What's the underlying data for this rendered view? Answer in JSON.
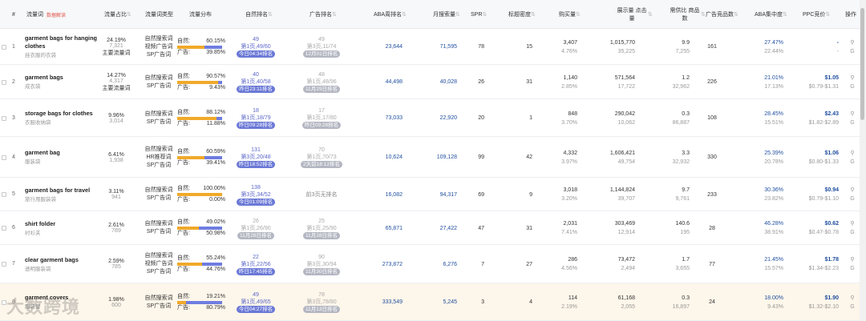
{
  "header": {
    "idx": "#",
    "keyword": "流量词",
    "keyword_tag": "数据解读",
    "share": "流量占比",
    "word_type": "流量词类型",
    "distribution": "流量分布",
    "natural_rank": "自然排名",
    "ad_rank": "广告排名",
    "aba_rank": "ABA周排名",
    "monthly_search": "月搜索量",
    "spr": "SPR",
    "title_density": "标题密度",
    "buy_volume": "购买量",
    "impr_click": "展示量 点击量",
    "supply_demand": "需供比 商品数",
    "ad_products": "广告竞品数",
    "aba_concentration": "ABA集中度",
    "ppc_bid": "PPC竞价",
    "action": "操作"
  },
  "labels": {
    "natural": "自然:",
    "ad": "广告:"
  },
  "rows": [
    {
      "idx": "1",
      "kw": "garment bags for hanging clothes",
      "kw_cn": "挂衣服的衣袋",
      "share": "24.19%",
      "share_n": "7,321",
      "share_t": "主要流量词",
      "type1": "自然搜索词",
      "type2": "视频广告词",
      "type3": "SP广告词",
      "nat": "60.15%",
      "adp": "39.85%",
      "nat_v": 0.6015,
      "nr1": "49",
      "nr2": "第1页,49/60",
      "nr3": "今日04:34排名",
      "nr_gray": false,
      "ar1": "49",
      "ar2": "第3页,11/74",
      "ar3": "12月01日排名",
      "aba": "23,644",
      "ms": "71,595",
      "spr": "78",
      "td": "15",
      "buy1": "3,407",
      "buy2": "4.76%",
      "imp1": "1,015,770",
      "imp2": "35,225",
      "sd1": "9.9",
      "sd2": "7,255",
      "adc": "161",
      "abc1": "27.47%",
      "abc2": "22.44%",
      "ppc1": "-",
      "ppc2": "-",
      "hl": false
    },
    {
      "idx": "2",
      "kw": "garment bags",
      "kw_cn": "成衣袋",
      "share": "14.27%",
      "share_n": "4,317",
      "share_t": "主要流量词",
      "type1": "自然搜索词",
      "type2": "SP广告词",
      "type3": "",
      "nat": "90.57%",
      "adp": "9.43%",
      "nat_v": 0.9057,
      "nr1": "40",
      "nr2": "第1页,40/58",
      "nr3": "昨日23:11排名",
      "nr_gray": false,
      "ar1": "48",
      "ar2": "第1页,48/96",
      "ar3": "11月29日排名",
      "aba": "44,498",
      "ms": "40,028",
      "spr": "26",
      "td": "31",
      "buy1": "1,140",
      "buy2": "2.85%",
      "imp1": "571,564",
      "imp2": "17,722",
      "sd1": "1.2",
      "sd2": "32,962",
      "adc": "226",
      "abc1": "21.01%",
      "abc2": "17.13%",
      "ppc1": "$1.05",
      "ppc2": "$0.79-$1.31",
      "hl": false
    },
    {
      "idx": "3",
      "kw": "storage bags for clothes",
      "kw_cn": "衣服收纳袋",
      "share": "9.96%",
      "share_n": "3,014",
      "share_t": "",
      "type1": "自然搜索词",
      "type2": "SP广告词",
      "type3": "",
      "nat": "88.12%",
      "adp": "11.88%",
      "nat_v": 0.8812,
      "nr1": "18",
      "nr2": "第1页,18/79",
      "nr3": "昨日09:28排名",
      "nr_gray": false,
      "ar1": "17",
      "ar2": "第1页,17/80",
      "ar3": "昨日09:28排名",
      "aba": "73,033",
      "ms": "22,920",
      "spr": "20",
      "td": "1",
      "buy1": "848",
      "buy2": "3.70%",
      "imp1": "290,042",
      "imp2": "10,062",
      "sd1": "0.3",
      "sd2": "86,887",
      "adc": "108",
      "abc1": "28.45%",
      "abc2": "15.51%",
      "ppc1": "$2.43",
      "ppc2": "$1.82-$2.89",
      "hl": false
    },
    {
      "idx": "4",
      "kw": "garment bag",
      "kw_cn": "服装袋",
      "share": "6.41%",
      "share_n": "1,938",
      "share_t": "",
      "type1": "自然搜索词",
      "type2": "HR推荐词",
      "type3": "SP广告词",
      "nat": "60.59%",
      "adp": "39.41%",
      "nat_v": 0.6059,
      "nr1": "131",
      "nr2": "第3页,20/48",
      "nr3": "昨日18:52排名",
      "nr_gray": false,
      "ar1": "70",
      "ar2": "第1页,70/73",
      "ar3": "2天前18:12排名",
      "aba": "10,624",
      "ms": "109,128",
      "spr": "99",
      "td": "42",
      "buy1": "4,332",
      "buy2": "3.97%",
      "imp1": "1,606,421",
      "imp2": "49,754",
      "sd1": "3.3",
      "sd2": "32,932",
      "adc": "330",
      "abc1": "25.39%",
      "abc2": "20.78%",
      "ppc1": "$1.06",
      "ppc2": "$0.80-$1.33",
      "hl": false
    },
    {
      "idx": "5",
      "kw": "garment bags for travel",
      "kw_cn": "旅行用服装袋",
      "share": "3.11%",
      "share_n": "941",
      "share_t": "",
      "type1": "自然搜索词",
      "type2": "SP广告词",
      "type3": "",
      "nat": "100.00%",
      "adp": "0.00%",
      "nat_v": 1.0,
      "nr1": "138",
      "nr2": "第3页,34/52",
      "nr3": "今日01:09排名",
      "nr_gray": false,
      "ar1": "",
      "ar2": "前3页无排名",
      "ar3": "",
      "aba": "16,082",
      "ms": "94,317",
      "spr": "69",
      "td": "9",
      "buy1": "3,018",
      "buy2": "3.20%",
      "imp1": "1,144,824",
      "imp2": "39,707",
      "sd1": "9.7",
      "sd2": "9,761",
      "adc": "233",
      "abc1": "30.36%",
      "abc2": "23.82%",
      "ppc1": "$0.94",
      "ppc2": "$0.79-$1.10",
      "hl": false
    },
    {
      "idx": "6",
      "kw": "shirt folder",
      "kw_cn": "衬衫夹",
      "share": "2.61%",
      "share_n": "789",
      "share_t": "",
      "type1": "自然搜索词",
      "type2": "SP广告词",
      "type3": "",
      "nat": "49.02%",
      "adp": "50.98%",
      "nat_v": 0.4902,
      "nr1": "26",
      "nr2": "第1页,26/90",
      "nr3": "11月28日排名",
      "nr_gray": true,
      "ar1": "25",
      "ar2": "第1页,25/90",
      "ar3": "11月28日排名",
      "aba": "65,871",
      "ms": "27,422",
      "spr": "47",
      "td": "31",
      "buy1": "2,031",
      "buy2": "7.41%",
      "imp1": "303,469",
      "imp2": "12,914",
      "sd1": "140.6",
      "sd2": "195",
      "adc": "28",
      "abc1": "46.28%",
      "abc2": "38.91%",
      "ppc1": "$0.62",
      "ppc2": "$0.47-$0.78",
      "hl": false
    },
    {
      "idx": "7",
      "kw": "clear garment bags",
      "kw_cn": "透明服装袋",
      "share": "2.59%",
      "share_n": "785",
      "share_t": "",
      "type1": "自然搜索词",
      "type2": "视频广告词",
      "type3": "SP广告词",
      "nat": "55.24%",
      "adp": "44.76%",
      "nat_v": 0.5524,
      "nr1": "22",
      "nr2": "第1页,22/56",
      "nr3": "昨日17:45排名",
      "nr_gray": false,
      "ar1": "90",
      "ar2": "第3页,30/94",
      "ar3": "11月30日排名",
      "aba": "273,872",
      "ms": "6,276",
      "spr": "7",
      "td": "27",
      "buy1": "286",
      "buy2": "4.56%",
      "imp1": "73,472",
      "imp2": "2,494",
      "sd1": "1.7",
      "sd2": "3,655",
      "adc": "77",
      "abc1": "21.45%",
      "abc2": "15.57%",
      "ppc1": "$1.78",
      "ppc2": "$1.34-$2.23",
      "hl": false
    },
    {
      "idx": "8",
      "kw": "garment covers",
      "kw_cn": "服装套",
      "share": "1.98%",
      "share_n": "600",
      "share_t": "",
      "type1": "自然搜索词",
      "type2": "SP广告词",
      "type3": "",
      "nat": "19.21%",
      "adp": "80.79%",
      "nat_v": 0.1921,
      "nr1": "49",
      "nr2": "第1页,49/65",
      "nr3": "今日04:27排名",
      "nr_gray": false,
      "ar1": "78",
      "ar2": "第3页,78/80",
      "ar3": "11月13日排名",
      "aba": "333,549",
      "ms": "5,245",
      "spr": "3",
      "td": "4",
      "buy1": "114",
      "buy2": "2.19%",
      "imp1": "61,168",
      "imp2": "2,055",
      "sd1": "0.3",
      "sd2": "16,897",
      "adc": "24",
      "abc1": "18.00%",
      "abc2": "9.43%",
      "ppc1": "$1.90",
      "ppc2": "$1.32-$2.10",
      "hl": true
    }
  ],
  "watermark": "大数跨境"
}
